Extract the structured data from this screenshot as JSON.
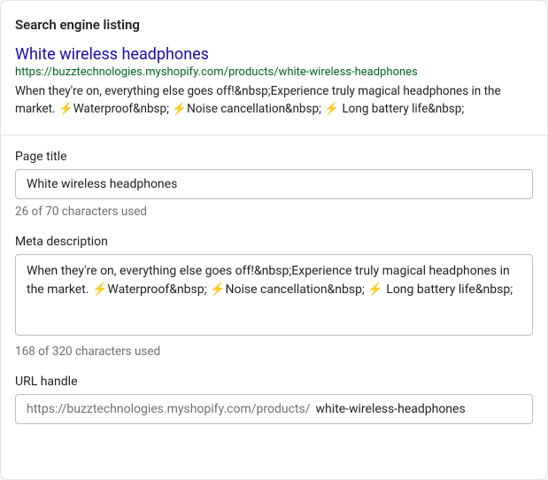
{
  "header": {
    "title": "Search engine listing"
  },
  "preview": {
    "title": "White wireless headphones",
    "url": "https://buzztechnologies.myshopify.com/products/white-wireless-headphones",
    "description": "When they're on, everything else goes off!&nbsp;Experience truly magical headphones in the market. ⚡Waterproof&nbsp; ⚡Noise cancellation&nbsp; ⚡ Long battery life&nbsp;"
  },
  "fields": {
    "page_title": {
      "label": "Page title",
      "value": "White wireless headphones",
      "char_count": "26 of 70 characters used"
    },
    "meta_description": {
      "label": "Meta description",
      "value": "When they're on, everything else goes off!&nbsp;Experience truly magical headphones in the market. ⚡Waterproof&nbsp; ⚡Noise cancellation&nbsp; ⚡ Long battery life&nbsp;",
      "char_count": "168 of 320 characters used"
    },
    "url_handle": {
      "label": "URL handle",
      "prefix": "https://buzztechnologies.myshopify.com/products/",
      "value": "white-wireless-headphones"
    }
  }
}
